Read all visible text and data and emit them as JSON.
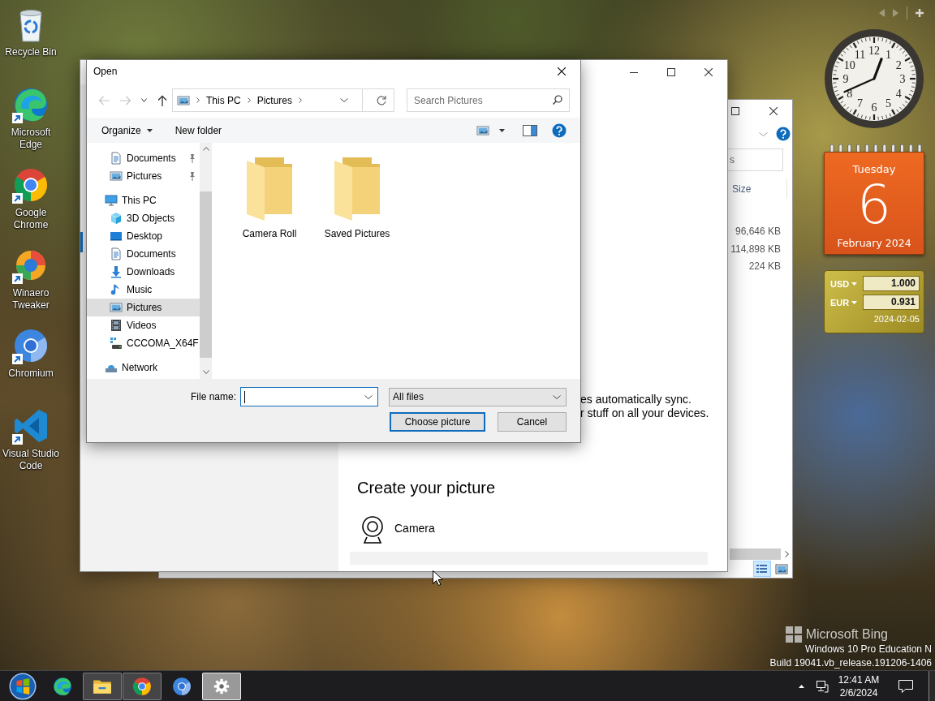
{
  "desktop_icons": [
    {
      "label": "Recycle Bin",
      "kind": "recycle_bin",
      "shortcut": false
    },
    {
      "label": "Microsoft Edge",
      "kind": "edge",
      "shortcut": true
    },
    {
      "label": "Google Chrome",
      "kind": "chrome",
      "shortcut": true
    },
    {
      "label": "Winaero Tweaker",
      "kind": "winaero",
      "shortcut": true
    },
    {
      "label": "Chromium",
      "kind": "chromium",
      "shortcut": true
    },
    {
      "label": "Visual Studio Code",
      "kind": "vscode",
      "shortcut": true
    }
  ],
  "explorer_window": {
    "search_placeholder": "s",
    "column": "Size",
    "sizes": [
      "96,646 KB",
      "114,898 KB",
      "224 KB"
    ],
    "views": [
      {
        "kind": "details",
        "selected": true
      },
      {
        "kind": "thumbnails",
        "selected": false
      }
    ]
  },
  "settings_window": {
    "description_lines": [
      "es automatically sync.",
      "r stuff on all your devices."
    ],
    "section_title": "Create your picture",
    "options": [
      {
        "label": "Camera",
        "kind": "camera"
      }
    ]
  },
  "open_dialog": {
    "title": "Open",
    "nav_buttons": [
      {
        "kind": "back",
        "disabled": true
      },
      {
        "kind": "forward",
        "disabled": true
      },
      {
        "kind": "recent",
        "disabled": false
      },
      {
        "kind": "up",
        "disabled": false
      }
    ],
    "address": [
      "This PC",
      "Pictures"
    ],
    "search_placeholder": "Search Pictures",
    "organize": "Organize",
    "new_folder": "New folder",
    "quick_access": [
      {
        "label": "Documents",
        "kind": "documents",
        "pinned": true,
        "selected": false
      },
      {
        "label": "Pictures",
        "kind": "pictures",
        "pinned": true,
        "selected": false
      }
    ],
    "nav_tree": [
      {
        "label": "This PC",
        "kind": "computer",
        "selected": false,
        "children": [
          {
            "label": "3D Objects",
            "kind": "objects3d",
            "selected": false
          },
          {
            "label": "Desktop",
            "kind": "desktop",
            "selected": false
          },
          {
            "label": "Documents",
            "kind": "documents",
            "selected": false
          },
          {
            "label": "Downloads",
            "kind": "downloads",
            "selected": false
          },
          {
            "label": "Music",
            "kind": "music",
            "selected": false
          },
          {
            "label": "Pictures",
            "kind": "pictures",
            "selected": true
          },
          {
            "label": "Videos",
            "kind": "videos",
            "selected": false
          },
          {
            "label": "CCCOMA_X64F",
            "kind": "drive",
            "selected": false
          }
        ]
      },
      {
        "label": "Network",
        "kind": "network",
        "selected": false
      }
    ],
    "folders": [
      "Camera Roll",
      "Saved Pictures"
    ],
    "file_name_label": "File name:",
    "file_name_field": {
      "focused": true
    },
    "file_type": "All files",
    "buttons": [
      {
        "label": "Choose picture",
        "kind": "confirm",
        "default": true
      },
      {
        "label": "Cancel",
        "kind": "cancel",
        "default": false
      }
    ]
  },
  "gadgets": {
    "clock": {
      "numerals": [
        "12",
        "11",
        "1",
        "10",
        "2",
        "9",
        "3",
        "8",
        "4",
        "7",
        "5",
        "6"
      ]
    },
    "calendar": {
      "weekday": "Tuesday",
      "day": "6",
      "month_year": "February 2024"
    },
    "currency": {
      "rows": [
        {
          "code": "USD",
          "value": "1.000"
        },
        {
          "code": "EUR",
          "value": "0.931"
        }
      ],
      "date": "2024-02-05"
    }
  },
  "system_overlay": {
    "logo_text": "Microsoft Bing",
    "edition": "Windows 10 Pro Education N",
    "build": "Build 19041.vb_release.191206-1406"
  },
  "taskbar": {
    "items": [
      {
        "kind": "start",
        "running": false,
        "active": false
      },
      {
        "kind": "edge",
        "running": false,
        "active": false
      },
      {
        "kind": "explorer",
        "running": true,
        "active": false
      },
      {
        "kind": "chrome",
        "running": true,
        "active": false
      },
      {
        "kind": "chromium",
        "running": false,
        "active": false
      },
      {
        "kind": "settings",
        "running": true,
        "active": true
      }
    ],
    "time": "12:41 AM",
    "date": "2/6/2024"
  }
}
